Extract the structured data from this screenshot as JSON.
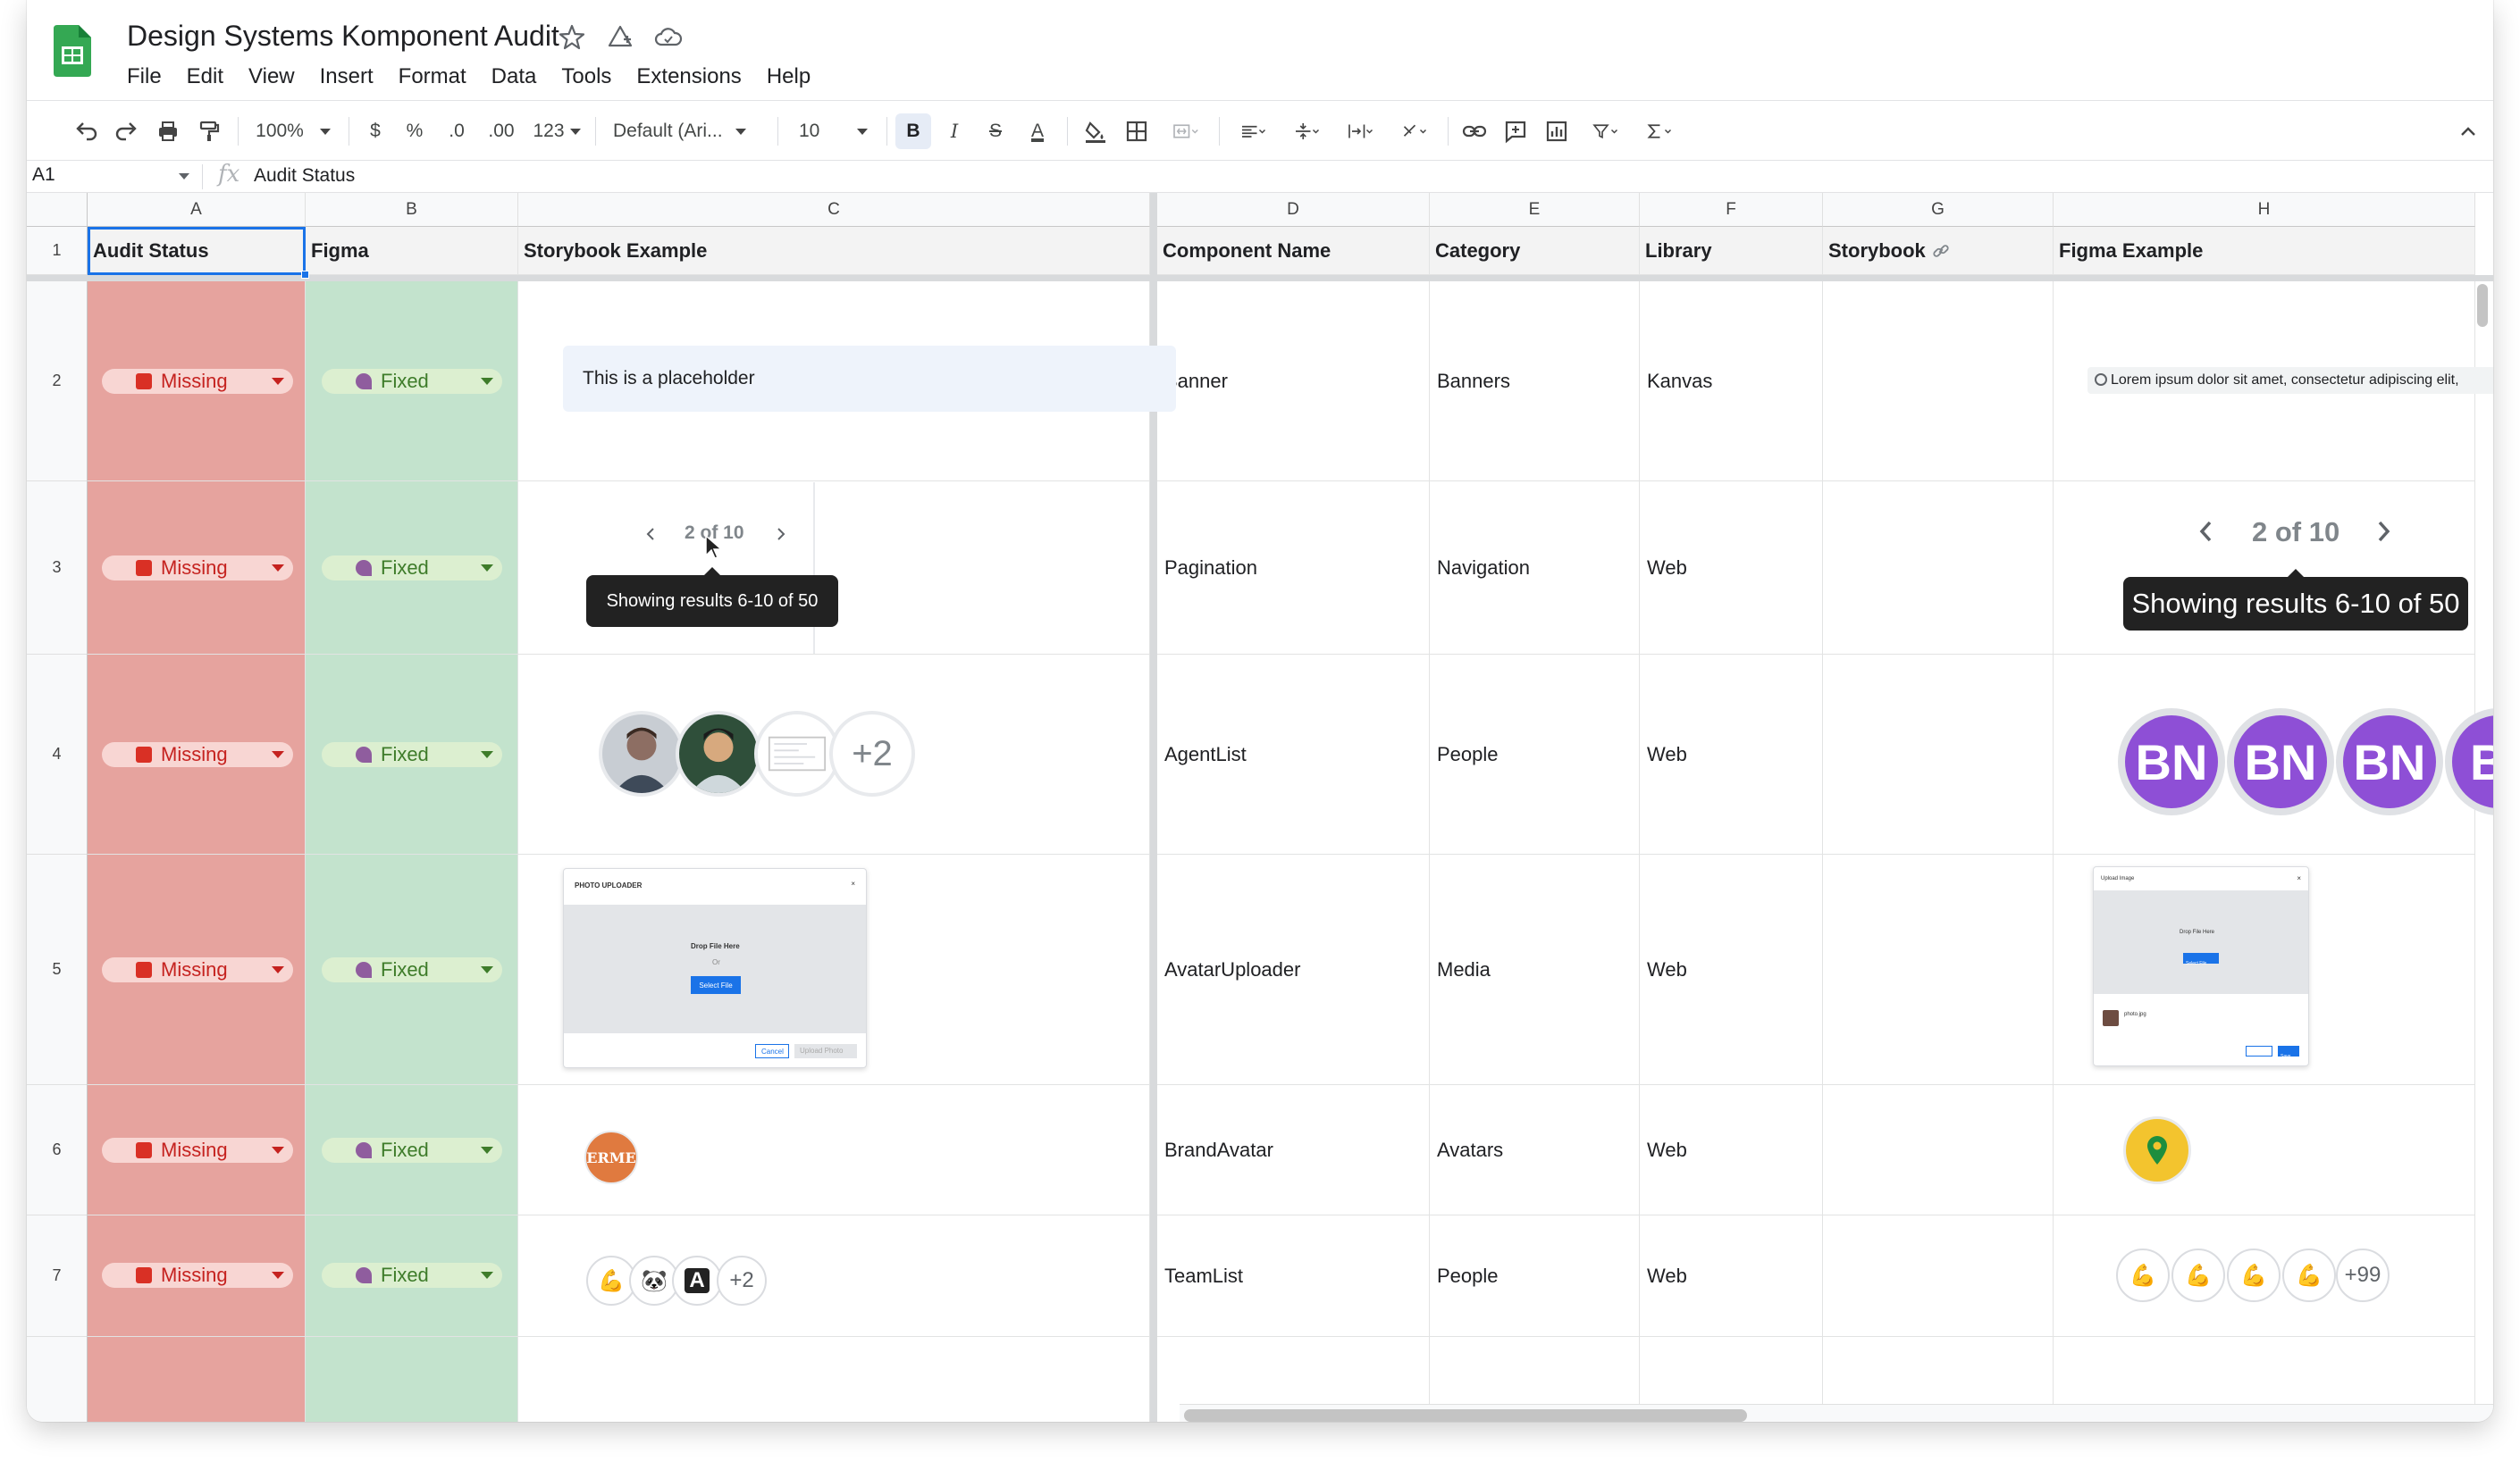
{
  "app": {
    "doc_title": "Design Systems Komponent Audit",
    "menu": [
      "File",
      "Edit",
      "View",
      "Insert",
      "Format",
      "Data",
      "Tools",
      "Extensions",
      "Help"
    ]
  },
  "toolbar": {
    "zoom": "100%",
    "currency": "$",
    "percent": "%",
    "decrease_decimal": ".0",
    "increase_decimal": ".00",
    "number_format": "123",
    "font": "Default (Ari...",
    "font_size": "10",
    "bold": "B",
    "italic": "I",
    "strike": "S",
    "text_color": "A"
  },
  "formula_bar": {
    "cell_ref": "A1",
    "fx": "fx",
    "value": "Audit Status"
  },
  "columns": [
    "A",
    "B",
    "C",
    "D",
    "E",
    "F",
    "G",
    "H"
  ],
  "rows": [
    "1",
    "2",
    "3",
    "4",
    "5",
    "6",
    "7"
  ],
  "headers": {
    "audit_status": "Audit Status",
    "figma": "Figma",
    "storybook_example": "Storybook Example",
    "component_name": "Component Name",
    "category": "Category",
    "library": "Library",
    "storybook": "Storybook",
    "figma_example": "Figma Example"
  },
  "status": {
    "missing": "Missing",
    "fixed": "Fixed"
  },
  "components": [
    {
      "name": "Banner",
      "category": "Banners",
      "library": "Kanvas"
    },
    {
      "name": "Pagination",
      "category": "Navigation",
      "library": "Web"
    },
    {
      "name": "AgentList",
      "category": "People",
      "library": "Web"
    },
    {
      "name": "AvatarUploader",
      "category": "Media",
      "library": "Web"
    },
    {
      "name": "BrandAvatar",
      "category": "Avatars",
      "library": "Web"
    },
    {
      "name": "TeamList",
      "category": "People",
      "library": "Web"
    }
  ],
  "previews": {
    "banner_text": "This is a placeholder",
    "figma_banner_text": "Lorem ipsum dolor sit amet, consectetur adipiscing elit,",
    "pager_text": "2 of 10",
    "tooltip": "Showing results 6-10 of 50",
    "avatar_more": "+2",
    "bn": "BN",
    "bn_partial": "B",
    "uploader_title": "PHOTO UPLOADER",
    "drop_text": "Drop File Here",
    "or_text": "Or",
    "select_file": "Select File",
    "cancel": "Cancel",
    "upload_photo": "Upload Photo",
    "figma_uploader_title": "Upload Image",
    "figma_file": "photo.jpg",
    "figma_save": "Save",
    "brand_text": "ERME",
    "team_more": "+2",
    "team_more_figma": "+99",
    "team_letter": "A"
  },
  "colors": {
    "missing_bg": "#e6a39e",
    "fixed_bg": "#c3e3cd",
    "selection": "#1a73e8",
    "avatar_purple": "#8e4fd6"
  }
}
